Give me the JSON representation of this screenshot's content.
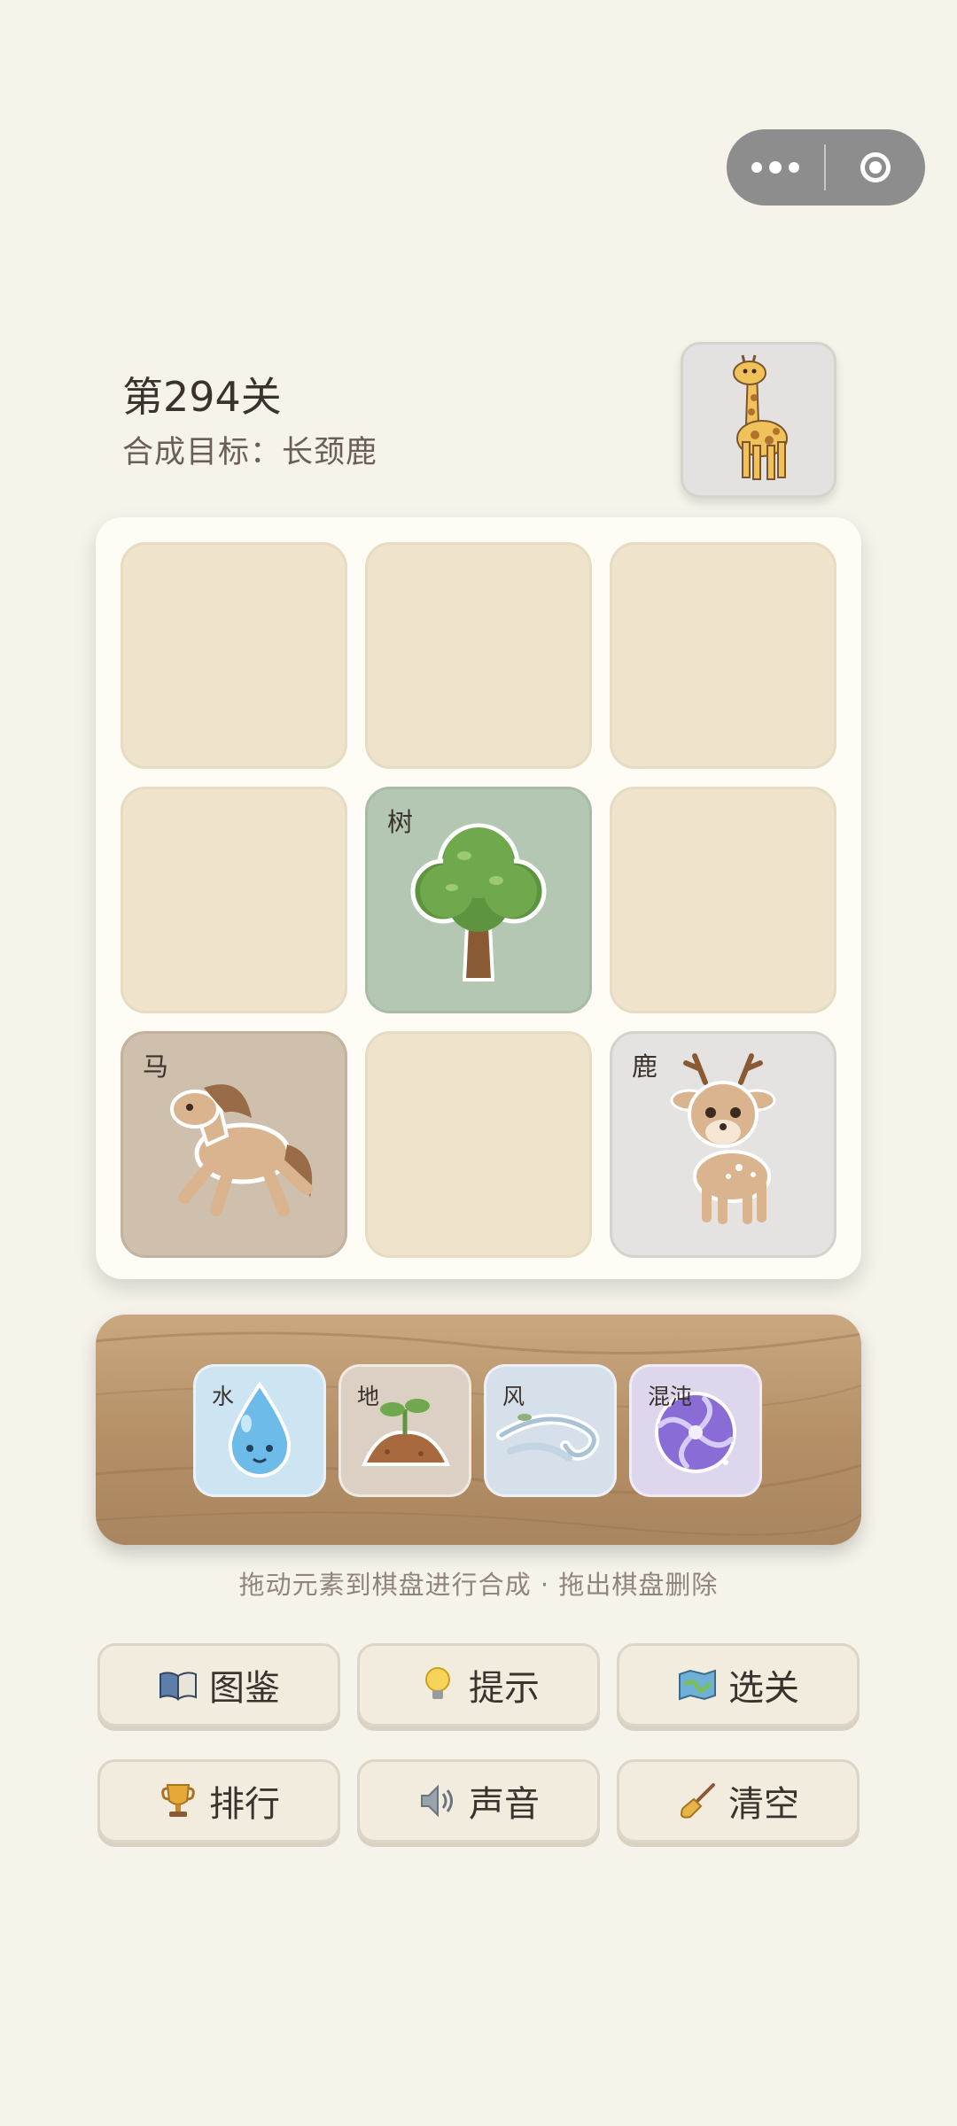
{
  "capsule": {
    "more_icon": "more-dots-icon",
    "close_icon": "target-circle-icon"
  },
  "level": {
    "title": "第294关",
    "goal_label": "合成目标：",
    "goal_name": "长颈鹿",
    "goal_icon": "giraffe"
  },
  "board": {
    "cells": [
      {
        "label": "",
        "icon": ""
      },
      {
        "label": "",
        "icon": ""
      },
      {
        "label": "",
        "icon": ""
      },
      {
        "label": "",
        "icon": ""
      },
      {
        "label": "树",
        "icon": "tree"
      },
      {
        "label": "",
        "icon": ""
      },
      {
        "label": "马",
        "icon": "horse"
      },
      {
        "label": "",
        "icon": ""
      },
      {
        "label": "鹿",
        "icon": "deer"
      }
    ]
  },
  "tray": {
    "elements": [
      {
        "label": "水",
        "icon": "water-drop",
        "color": "#cde4f2"
      },
      {
        "label": "地",
        "icon": "soil-sprout",
        "color": "#dccfc3"
      },
      {
        "label": "风",
        "icon": "wind",
        "color": "#d6e0ea"
      },
      {
        "label": "混沌",
        "icon": "chaos-swirl",
        "color": "#ddd6ec"
      }
    ]
  },
  "hint": "拖动元素到棋盘进行合成 · 拖出棋盘删除",
  "buttons": [
    {
      "label": "图鉴",
      "icon": "book-icon"
    },
    {
      "label": "提示",
      "icon": "bulb-icon"
    },
    {
      "label": "选关",
      "icon": "map-icon"
    },
    {
      "label": "排行",
      "icon": "trophy-icon"
    },
    {
      "label": "声音",
      "icon": "speaker-icon"
    },
    {
      "label": "清空",
      "icon": "broom-icon"
    }
  ]
}
